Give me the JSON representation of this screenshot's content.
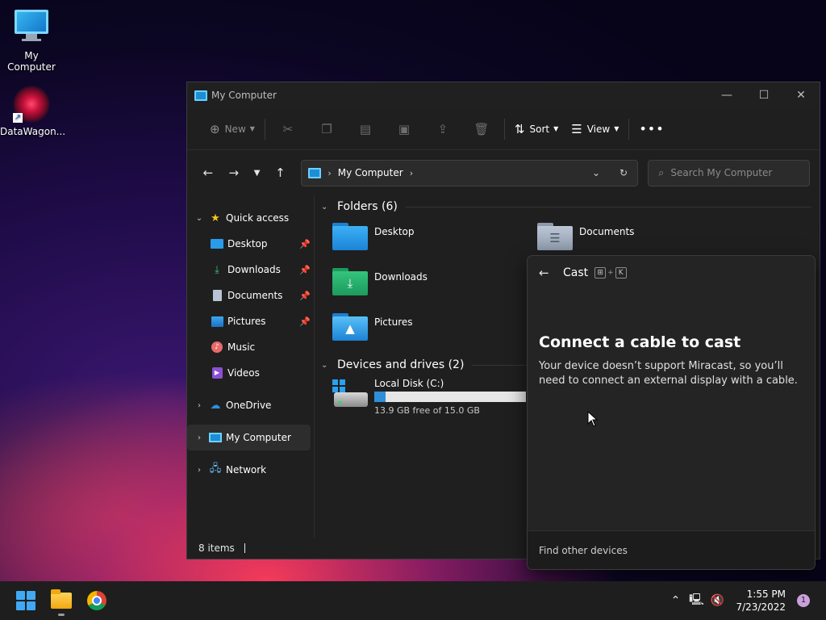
{
  "desktop": {
    "icons": [
      {
        "label": "My Computer"
      },
      {
        "label": "DataWagon..."
      }
    ]
  },
  "window": {
    "title": "My Computer",
    "toolbar": {
      "new_label": "New",
      "sort_label": "Sort",
      "view_label": "View"
    },
    "address": {
      "crumb": "My Computer"
    },
    "search": {
      "placeholder": "Search My Computer"
    },
    "sidebar": {
      "quick_access": "Quick access",
      "items": [
        {
          "label": "Desktop"
        },
        {
          "label": "Downloads"
        },
        {
          "label": "Documents"
        },
        {
          "label": "Pictures"
        },
        {
          "label": "Music"
        },
        {
          "label": "Videos"
        }
      ],
      "onedrive": "OneDrive",
      "my_computer": "My Computer",
      "network": "Network"
    },
    "folders_header": "Folders (6)",
    "folders": [
      {
        "name": "Desktop"
      },
      {
        "name": "Documents"
      },
      {
        "name": "Downloads"
      },
      {
        "name": "Pictures"
      }
    ],
    "drives_header": "Devices and drives (2)",
    "drive": {
      "name": "Local Disk (C:)",
      "free_text": "13.9 GB free of 15.0 GB",
      "used_fraction": 0.073
    },
    "status": "8 items"
  },
  "cast": {
    "title": "Cast",
    "shortcut_key": "K",
    "heading": "Connect a cable to cast",
    "message": "Your device doesn’t support Miracast, so you’ll need to connect an external display with a cable.",
    "footer": "Find other devices"
  },
  "taskbar": {
    "time": "1:55 PM",
    "date": "7/23/2022",
    "notification_count": "1"
  },
  "colors": {
    "accent": "#2e8fd8",
    "window_bg": "#1f1f1f",
    "taskbar_bg": "#1e1e1e"
  }
}
